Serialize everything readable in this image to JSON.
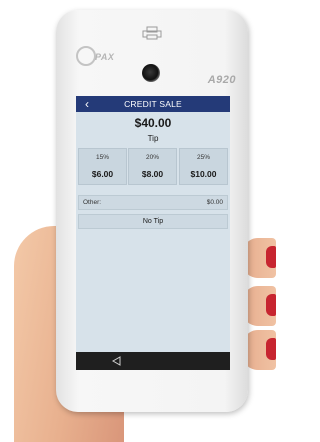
{
  "device": {
    "brand": "PAX",
    "model": "A920"
  },
  "screen": {
    "title": "CREDIT SALE",
    "amount": "$40.00",
    "tip_label": "Tip",
    "tip_options": [
      {
        "percent": "15%",
        "value": "$6.00"
      },
      {
        "percent": "20%",
        "value": "$8.00"
      },
      {
        "percent": "25%",
        "value": "$10.00"
      }
    ],
    "other_label": "Other:",
    "other_value": "$0.00",
    "no_tip_label": "No Tip"
  },
  "icons": {
    "back": "back-chevron-icon",
    "nav_back": "nav-back-triangle-icon",
    "printer": "printer-icon"
  }
}
